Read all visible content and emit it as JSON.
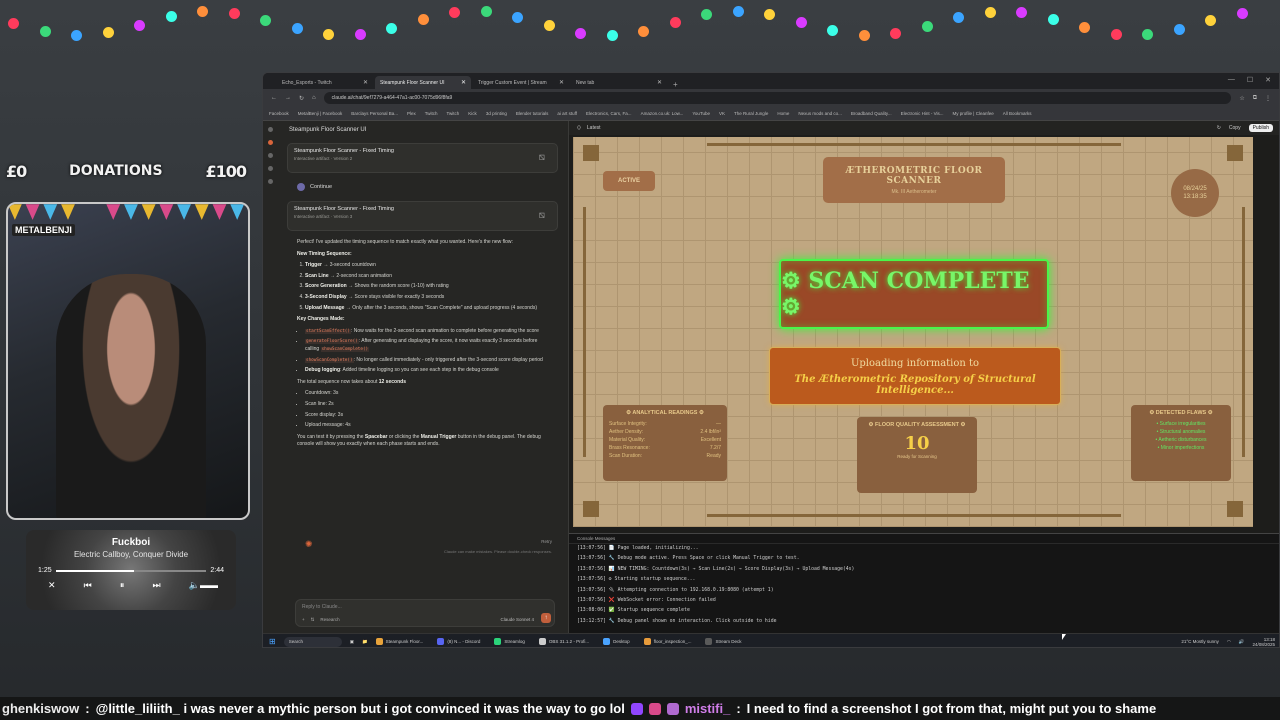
{
  "overlay": {
    "donation_current": "£0",
    "donation_label": "DONATIONS",
    "donation_goal": "£100",
    "webcam_label": "METALBENJI"
  },
  "now_playing": {
    "title": "Fuckboi",
    "artist": "Electric Callboy, Conquer Divide",
    "elapsed": "1:25",
    "duration": "2:44",
    "progress": 0.52
  },
  "browser": {
    "tabs": [
      {
        "label": "Echo_Esports - Twitch"
      },
      {
        "label": "Steampunk Floor Scanner UI"
      },
      {
        "label": "Trigger Custom Event | Stream"
      },
      {
        "label": "New tab"
      }
    ],
    "url": "claude.ai/chat/9ef7279-a464-47a1-ac00-7075d96f8fa9",
    "bookmarks": [
      "Facebook",
      "MetalBenji | Facebook",
      "Barclays Personal Ba...",
      "Plex",
      "Twitch",
      "Twitch",
      "Kick",
      "3d printing",
      "Blender tutorials",
      "ai art stuff",
      "Electronics, Cars, Fa...",
      "Amazon.co.uk: Low...",
      "YouTube",
      "VK",
      "The Rural Jungle",
      "Home",
      "Nexus mods and co...",
      "Broadband Quality...",
      "Electronic Hint - Vis...",
      "My profile | Cleanfee",
      "All Bookmarks"
    ]
  },
  "chat": {
    "title": "Steampunk Floor Scanner UI",
    "card1_title": "Steampunk Floor Scanner - Fixed Timing",
    "card1_sub": "Interactive artifact · Version 2",
    "continue_label": "Continue",
    "card2_title": "Steampunk Floor Scanner - Fixed Timing",
    "card2_sub": "Interactive artifact · Version 3",
    "intro": "Perfect! I've updated the timing sequence to match exactly what you wanted. Here's the new flow:",
    "timing_heading": "New Timing Sequence:",
    "steps": [
      {
        "b": "Trigger",
        "t": " → 3-second countdown"
      },
      {
        "b": "Scan Line",
        "t": " → 2-second scan animation"
      },
      {
        "b": "Score Generation",
        "t": " → Shows the random score (1-10) with rating"
      },
      {
        "b": "3-Second Display",
        "t": " → Score stays visible for exactly 3 seconds"
      },
      {
        "b": "Upload Message",
        "t": " → Only after the 3 seconds, shows \"Scan Complete\" and upload progress (4 seconds)"
      }
    ],
    "changes_heading": "Key Changes Made:",
    "changes": [
      {
        "c": "startScanEffect()",
        "t": ": Now waits for the 2-second scan animation to complete before generating the score"
      },
      {
        "c": "generateFloorScore()",
        "t": ": After generating and displaying the score, it now waits exactly 3 seconds before calling ",
        "c2": "showScanComplete()"
      },
      {
        "c": "showScanComplete()",
        "t": ": No longer called immediately - only triggered after the 3-second score display period"
      },
      {
        "b": "Debug logging",
        "t": ": Added timeline logging so you can see each step in the debug console"
      }
    ],
    "total_prefix": "The total sequence now takes about ",
    "total_value": "12 seconds",
    "breakdown": [
      "Countdown: 3s",
      "Scan line: 2s",
      "Score display: 3s",
      "Upload message: 4s"
    ],
    "test_a": "You can test it by pressing the ",
    "test_b": "Spacebar",
    "test_c": " or clicking the ",
    "test_d": "Manual Trigger",
    "test_e": " button in the debug panel. The debug console will show you exactly when each phase starts and ends.",
    "retry": "Retry",
    "disclaimer": "Claude can make mistakes. Please double-check responses.",
    "reply_placeholder": "Reply to Claude...",
    "research_label": "Research",
    "model_label": "Claude Sonnet 4"
  },
  "preview": {
    "tab_label": "Latest",
    "copy_label": "Copy",
    "publish_label": "Publish",
    "active_label": "ACTIVE",
    "scanner_title": "ÆTHEROMETRIC FLOOR SCANNER",
    "scanner_sub": "Mk. III Aetherometer",
    "clock_date": "08/24/25",
    "clock_time": "13:18:35",
    "scan_complete": "⚙ SCAN COMPLETE ⚙",
    "upload_line1": "Uploading information to",
    "upload_line2": "The Ætherometric Repository of Structural Intelligence...",
    "analytics_title": "⚙ ANALYTICAL READINGS ⚙",
    "analytics_rows": [
      {
        "k": "Surface Integrity:",
        "v": "—"
      },
      {
        "k": "Aether Density:",
        "v": "2.4 lbf/in²"
      },
      {
        "k": "Material Quality:",
        "v": "Excellent"
      },
      {
        "k": "Brass Resonance:",
        "v": "7.2/7"
      },
      {
        "k": "Scan Duration:",
        "v": "Ready"
      }
    ],
    "quality_title": "⚙ FLOOR QUALITY ASSESSMENT ⚙",
    "quality_score": "10",
    "quality_note": "Ready for Scanning",
    "defects_title": "⚙ DETECTED FLAWS ⚙",
    "defects": [
      "• Surface irregularities",
      "• Structural anomalies",
      "• Aetheric disturbances",
      "• Minor imperfections"
    ]
  },
  "console": {
    "header": "Console Messages",
    "lines": [
      "[13:07:56] 📄 Page loaded, initializing...",
      "[13:07:56] 🔧 Debug mode active. Press Space or click Manual Trigger to test.",
      "[13:07:56] 📊 NEW TIMING: Countdown(3s) → Scan Line(2s) → Score Display(3s) → Upload Message(4s)",
      "[13:07:56] ⚙ Starting startup sequence...",
      "[13:07:56] 🔌 Attempting connection to 192.168.0.19:8080 (attempt 1)",
      "[13:07:56] ❌ WebSocket error: Connection failed",
      "[13:08:06] ✅ Startup sequence complete",
      "[13:12:57] 🔧 Debug panel shown on interaction. Click outside to hide"
    ]
  },
  "taskbar": {
    "search": "Search",
    "apps": [
      "Steampunk Floor...",
      "(8) N... - Discord",
      "Streamlog",
      "OBS 31.1.2 - Profi...",
      "Desktop",
      "floor_inspection_...",
      "Stream Deck"
    ],
    "weather": "21°C Mostly sunny",
    "time": "13:18",
    "date": "24/08/2025"
  },
  "ticker": {
    "user1": "ghenkiswow",
    "msg1": "@little_liliith_ i was never a mythic person but i got convinced it was the way to go lol",
    "user2": "mistifi_",
    "msg2": "I need to find a screenshot I got from that, might put you to shame"
  }
}
